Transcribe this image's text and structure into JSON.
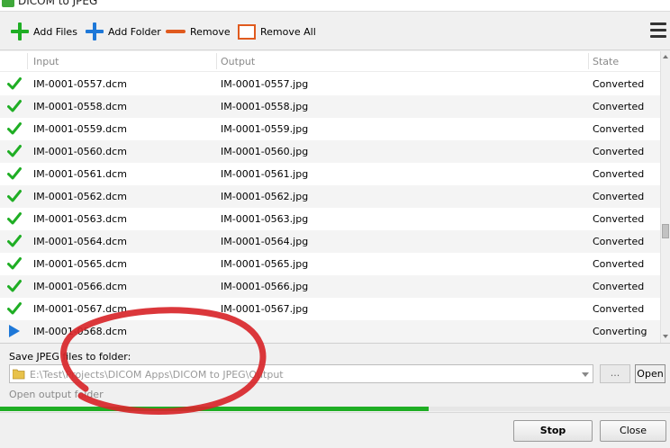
{
  "window": {
    "title": "DICOM to JPEG"
  },
  "toolbar": {
    "add_files": "Add Files",
    "add_folder": "Add Folder",
    "remove": "Remove",
    "remove_all": "Remove All"
  },
  "colors": {
    "green": "#1fae24",
    "blue": "#1e78d8",
    "orange": "#e05a1e",
    "annotation": "#d8262a"
  },
  "table": {
    "headers": {
      "input": "Input",
      "output": "Output",
      "state": "State"
    },
    "rows": [
      {
        "status": "check-icon",
        "input": "IM-0001-0557.dcm",
        "output": "IM-0001-0557.jpg",
        "state": "Converted"
      },
      {
        "status": "check-icon",
        "input": "IM-0001-0558.dcm",
        "output": "IM-0001-0558.jpg",
        "state": "Converted"
      },
      {
        "status": "check-icon",
        "input": "IM-0001-0559.dcm",
        "output": "IM-0001-0559.jpg",
        "state": "Converted"
      },
      {
        "status": "check-icon",
        "input": "IM-0001-0560.dcm",
        "output": "IM-0001-0560.jpg",
        "state": "Converted"
      },
      {
        "status": "check-icon",
        "input": "IM-0001-0561.dcm",
        "output": "IM-0001-0561.jpg",
        "state": "Converted"
      },
      {
        "status": "check-icon",
        "input": "IM-0001-0562.dcm",
        "output": "IM-0001-0562.jpg",
        "state": "Converted"
      },
      {
        "status": "check-icon",
        "input": "IM-0001-0563.dcm",
        "output": "IM-0001-0563.jpg",
        "state": "Converted"
      },
      {
        "status": "check-icon",
        "input": "IM-0001-0564.dcm",
        "output": "IM-0001-0564.jpg",
        "state": "Converted"
      },
      {
        "status": "check-icon",
        "input": "IM-0001-0565.dcm",
        "output": "IM-0001-0565.jpg",
        "state": "Converted"
      },
      {
        "status": "check-icon",
        "input": "IM-0001-0566.dcm",
        "output": "IM-0001-0566.jpg",
        "state": "Converted"
      },
      {
        "status": "check-icon",
        "input": "IM-0001-0567.dcm",
        "output": "IM-0001-0567.jpg",
        "state": "Converted"
      },
      {
        "status": "play-icon",
        "input": "IM-0001-0568.dcm",
        "output": "",
        "state": "Converting"
      }
    ]
  },
  "save": {
    "label": "Save JPEG files to folder:",
    "path": "E:\\Test\\Projects\\DICOM Apps\\DICOM to JPEG\\Output",
    "browse_label": "...",
    "open_label": "Open",
    "open_folder_link": "Open output folder"
  },
  "progress": {
    "fraction": 0.64
  },
  "footer": {
    "stop": "Stop",
    "close": "Close"
  }
}
